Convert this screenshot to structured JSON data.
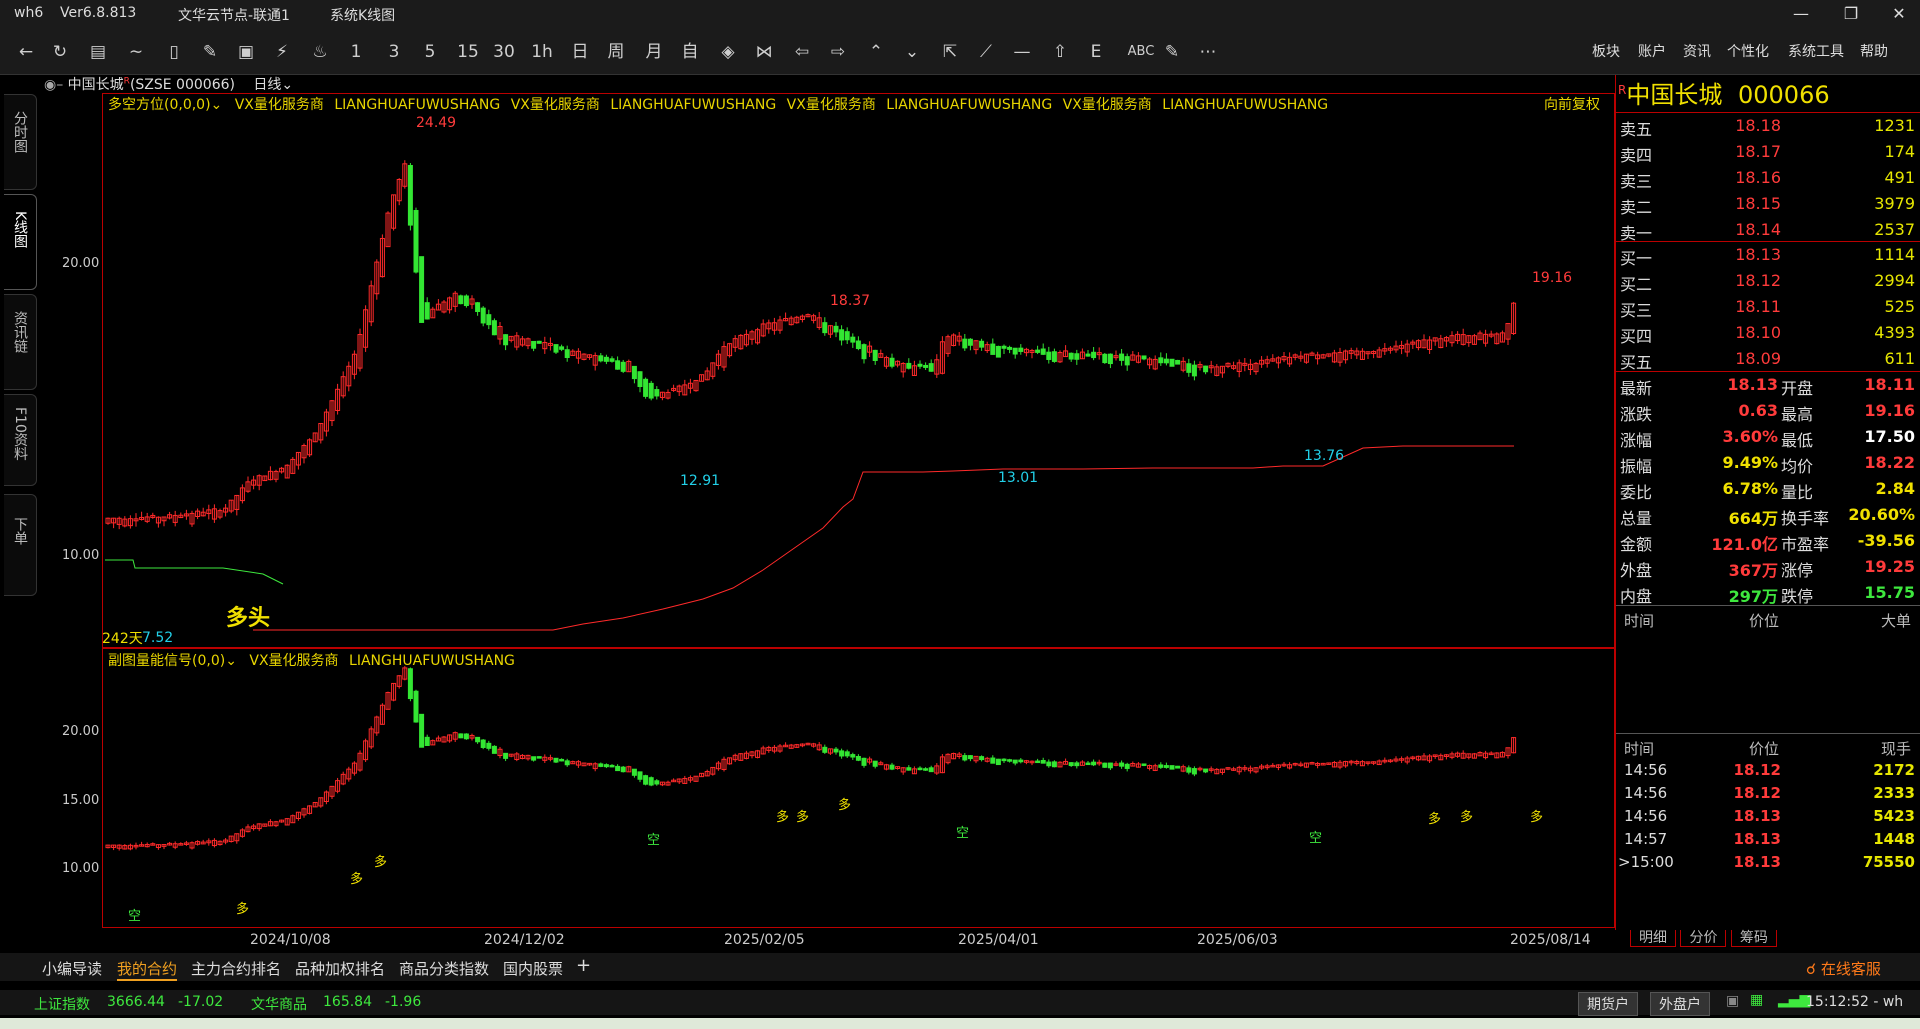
{
  "app": {
    "name": "wh6",
    "version": "Ver6.8.813",
    "node": "文华云节点-联通1",
    "view": "系统K线图"
  },
  "toolbar": {
    "periods": [
      "1",
      "3",
      "5",
      "15",
      "30",
      "1h",
      "日",
      "周",
      "月",
      "自"
    ],
    "extra_text": "ABC",
    "menu": [
      "板块",
      "账户",
      "资讯",
      "个性化",
      "系统工具",
      "帮助"
    ]
  },
  "left_tabs": [
    "分时图",
    "K线图",
    "资讯链",
    "F10资料",
    "下单"
  ],
  "instrument": {
    "name": "中国长城",
    "code_label": "(SZSE 000066)",
    "period": "日线",
    "code": "000066",
    "r_mark": "R"
  },
  "main_chart": {
    "indicator": "多空方位(0,0,0)",
    "vendor_repeats": [
      "VX量化服务商",
      "LIANGHUAFUWUSHANG",
      "VX量化服务商",
      "LIANGHUAFUWUSHANG",
      "VX量化服务商",
      "LIANGHUAFUWUSHANG",
      "VX量化服务商",
      "LIANGHUAFUWUSHANG"
    ],
    "adjust": "向前复权",
    "annotations": {
      "high_main": "24.49",
      "mid_high": "18.37",
      "low1": "12.91",
      "low2": "13.01",
      "low3": "13.76",
      "last_high": "19.16",
      "start_low": "7.52",
      "days": "242天",
      "signal": "多头"
    },
    "y_ticks": [
      "20.00",
      "10.00"
    ]
  },
  "sub_chart": {
    "indicator": "副图量能信号(0,0)",
    "vendor": "VX量化服务商",
    "vendor2": "LIANGHUAFUWUSHANG",
    "y_ticks": [
      "20.00",
      "15.00",
      "10.00"
    ],
    "signals": [
      {
        "label": "空",
        "color": "#3ee83e"
      },
      {
        "label": "多",
        "color": "#f0e000"
      },
      {
        "label": "多",
        "color": "#f0e000"
      },
      {
        "label": "多",
        "color": "#f0e000"
      },
      {
        "label": "空",
        "color": "#3ee83e"
      },
      {
        "label": "多",
        "color": "#f0e000"
      },
      {
        "label": "多",
        "color": "#f0e000"
      },
      {
        "label": "多",
        "color": "#f0e000"
      },
      {
        "label": "空",
        "color": "#3ee83e"
      },
      {
        "label": "空",
        "color": "#3ee83e"
      },
      {
        "label": "多",
        "color": "#f0e000"
      },
      {
        "label": "多",
        "color": "#f0e000"
      },
      {
        "label": "多",
        "color": "#f0e000"
      }
    ]
  },
  "x_axis_dates": [
    "2024/10/08",
    "2024/12/02",
    "2025/02/05",
    "2025/04/01",
    "2025/06/03",
    "2025/08/14"
  ],
  "order_book": {
    "asks": [
      {
        "label": "卖五",
        "price": "18.18",
        "vol": "1231"
      },
      {
        "label": "卖四",
        "price": "18.17",
        "vol": "174"
      },
      {
        "label": "卖三",
        "price": "18.16",
        "vol": "491"
      },
      {
        "label": "卖二",
        "price": "18.15",
        "vol": "3979"
      },
      {
        "label": "卖一",
        "price": "18.14",
        "vol": "2537"
      }
    ],
    "bids": [
      {
        "label": "买一",
        "price": "18.13",
        "vol": "1114"
      },
      {
        "label": "买二",
        "price": "18.12",
        "vol": "2994"
      },
      {
        "label": "买三",
        "price": "18.11",
        "vol": "525"
      },
      {
        "label": "买四",
        "price": "18.10",
        "vol": "4393"
      },
      {
        "label": "买五",
        "price": "18.09",
        "vol": "611"
      }
    ]
  },
  "stats": [
    {
      "l1": "最新",
      "v1": "18.13",
      "c1": "red",
      "l2": "开盘",
      "v2": "18.11",
      "c2": "red"
    },
    {
      "l1": "涨跌",
      "v1": "0.63",
      "c1": "red",
      "l2": "最高",
      "v2": "19.16",
      "c2": "red"
    },
    {
      "l1": "涨幅",
      "v1": "3.60%",
      "c1": "red",
      "l2": "最低",
      "v2": "17.50",
      "c2": "wht"
    },
    {
      "l1": "振幅",
      "v1": "9.49%",
      "c1": "yel",
      "l2": "均价",
      "v2": "18.22",
      "c2": "red"
    },
    {
      "l1": "委比",
      "v1": "6.78%",
      "c1": "yel",
      "l2": "量比",
      "v2": "2.84",
      "c2": "yel"
    },
    {
      "l1": "总量",
      "v1": "664万",
      "c1": "yel",
      "l2": "换手率",
      "v2": "20.60%",
      "c2": "yel"
    },
    {
      "l1": "金额",
      "v1": "121.0亿",
      "c1": "red",
      "l2": "市盈率",
      "v2": "-39.56",
      "c2": "yel"
    },
    {
      "l1": "外盘",
      "v1": "367万",
      "c1": "red",
      "l2": "涨停",
      "v2": "19.25",
      "c2": "red"
    },
    {
      "l1": "内盘",
      "v1": "297万",
      "c1": "green",
      "l2": "跌停",
      "v2": "15.75",
      "c2": "green"
    }
  ],
  "big_orders_header": {
    "time": "时间",
    "price": "价位",
    "size": "大单"
  },
  "ticks_header": {
    "time": "时间",
    "price": "价位",
    "size": "现手"
  },
  "ticks": [
    {
      "time": "14:56",
      "price": "18.12",
      "size": "2172",
      "pc": "red",
      "sc": "green"
    },
    {
      "time": "14:56",
      "price": "18.12",
      "size": "2333",
      "pc": "red",
      "sc": "green"
    },
    {
      "time": "14:56",
      "price": "18.13",
      "size": "5423",
      "pc": "red",
      "sc": "red"
    },
    {
      "time": "14:57",
      "price": "18.13",
      "size": "1448",
      "pc": "red",
      "sc": "green"
    },
    {
      "time": ">15:00",
      "price": "18.13",
      "size": "75550",
      "pc": "red",
      "sc": "red"
    }
  ],
  "right_tabs": [
    "明细",
    "分价",
    "筹码"
  ],
  "bottom_tabs": [
    "小编导读",
    "我的合约",
    "主力合约排名",
    "品种加权排名",
    "商品分类指数",
    "国内股票"
  ],
  "service": "在线客服",
  "status": {
    "idx1_name": "上证指数",
    "idx1_val": "3666.44",
    "idx1_chg": "-17.02",
    "idx2_name": "文华商品",
    "idx2_val": "165.84",
    "idx2_chg": "-1.96",
    "btn1": "期货户",
    "btn2": "外盘户",
    "clock": "15:12:52 - wh"
  },
  "colors": {
    "up": "#ff3b3b",
    "down": "#3ee83e",
    "label": "#f0e000",
    "cyan": "#22d0e8",
    "frame": "#b00000"
  }
}
